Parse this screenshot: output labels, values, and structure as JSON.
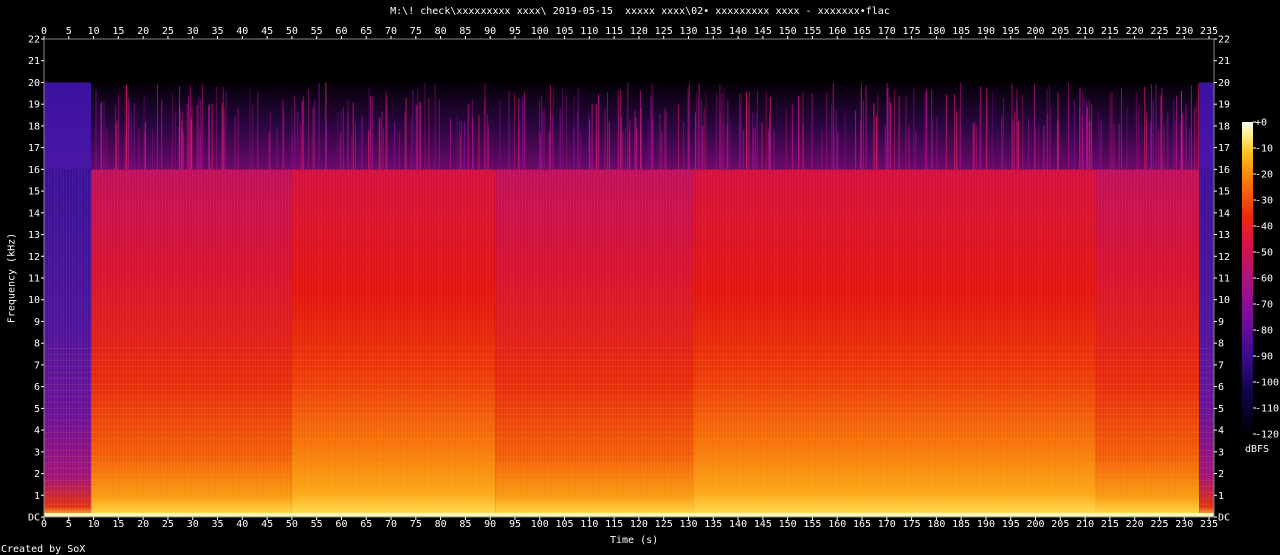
{
  "title": "M:\\! check\\xxxxxxxxx xxxx\\ 2019-05-15  xxxxx xxxx\\02• xxxxxxxxx xxxx - xxxxxxx•flac",
  "credit": "Created by SoX",
  "chart_data": {
    "type": "heatmap",
    "title": "M:\\! check\\xxxxxxxxx xxxx\\ 2019-05-15  xxxxx xxxx\\02• xxxxxxxxx xxxx - xxxxxxx•flac",
    "xlabel": "Time (s)",
    "ylabel": "Frequency (kHz)",
    "xlim": [
      0,
      236
    ],
    "ylim": [
      0,
      22
    ],
    "x_ticks": [
      0,
      5,
      10,
      15,
      20,
      25,
      30,
      35,
      40,
      45,
      50,
      55,
      60,
      65,
      70,
      75,
      80,
      85,
      90,
      95,
      100,
      105,
      110,
      115,
      120,
      125,
      130,
      135,
      140,
      145,
      150,
      155,
      160,
      165,
      170,
      175,
      180,
      185,
      190,
      195,
      200,
      205,
      210,
      215,
      220,
      225,
      230,
      235
    ],
    "y_ticks": [
      "DC",
      "1",
      "2",
      "3",
      "4",
      "5",
      "6",
      "7",
      "8",
      "9",
      "10",
      "11",
      "12",
      "13",
      "14",
      "15",
      "16",
      "17",
      "18",
      "19",
      "20",
      "21",
      "22"
    ],
    "colorbar": {
      "label": "dBFS",
      "ticks": [
        "+0",
        "-10",
        "-20",
        "-30",
        "-40",
        "-50",
        "-60",
        "-70",
        "-80",
        "-90",
        "-100",
        "-110",
        "-120"
      ],
      "range": [
        -120,
        0
      ]
    },
    "lowpass_cutoff_khz": 16,
    "upper_band_max_khz": 20,
    "segments": [
      {
        "start": 0,
        "end": 9.5,
        "level": "quiet"
      },
      {
        "start": 9.5,
        "end": 50,
        "level": "medium"
      },
      {
        "start": 50,
        "end": 91,
        "level": "loud"
      },
      {
        "start": 91,
        "end": 131,
        "level": "medium"
      },
      {
        "start": 131,
        "end": 212,
        "level": "loud"
      },
      {
        "start": 212,
        "end": 233,
        "level": "medium"
      },
      {
        "start": 233,
        "end": 236,
        "level": "quiet"
      }
    ]
  }
}
